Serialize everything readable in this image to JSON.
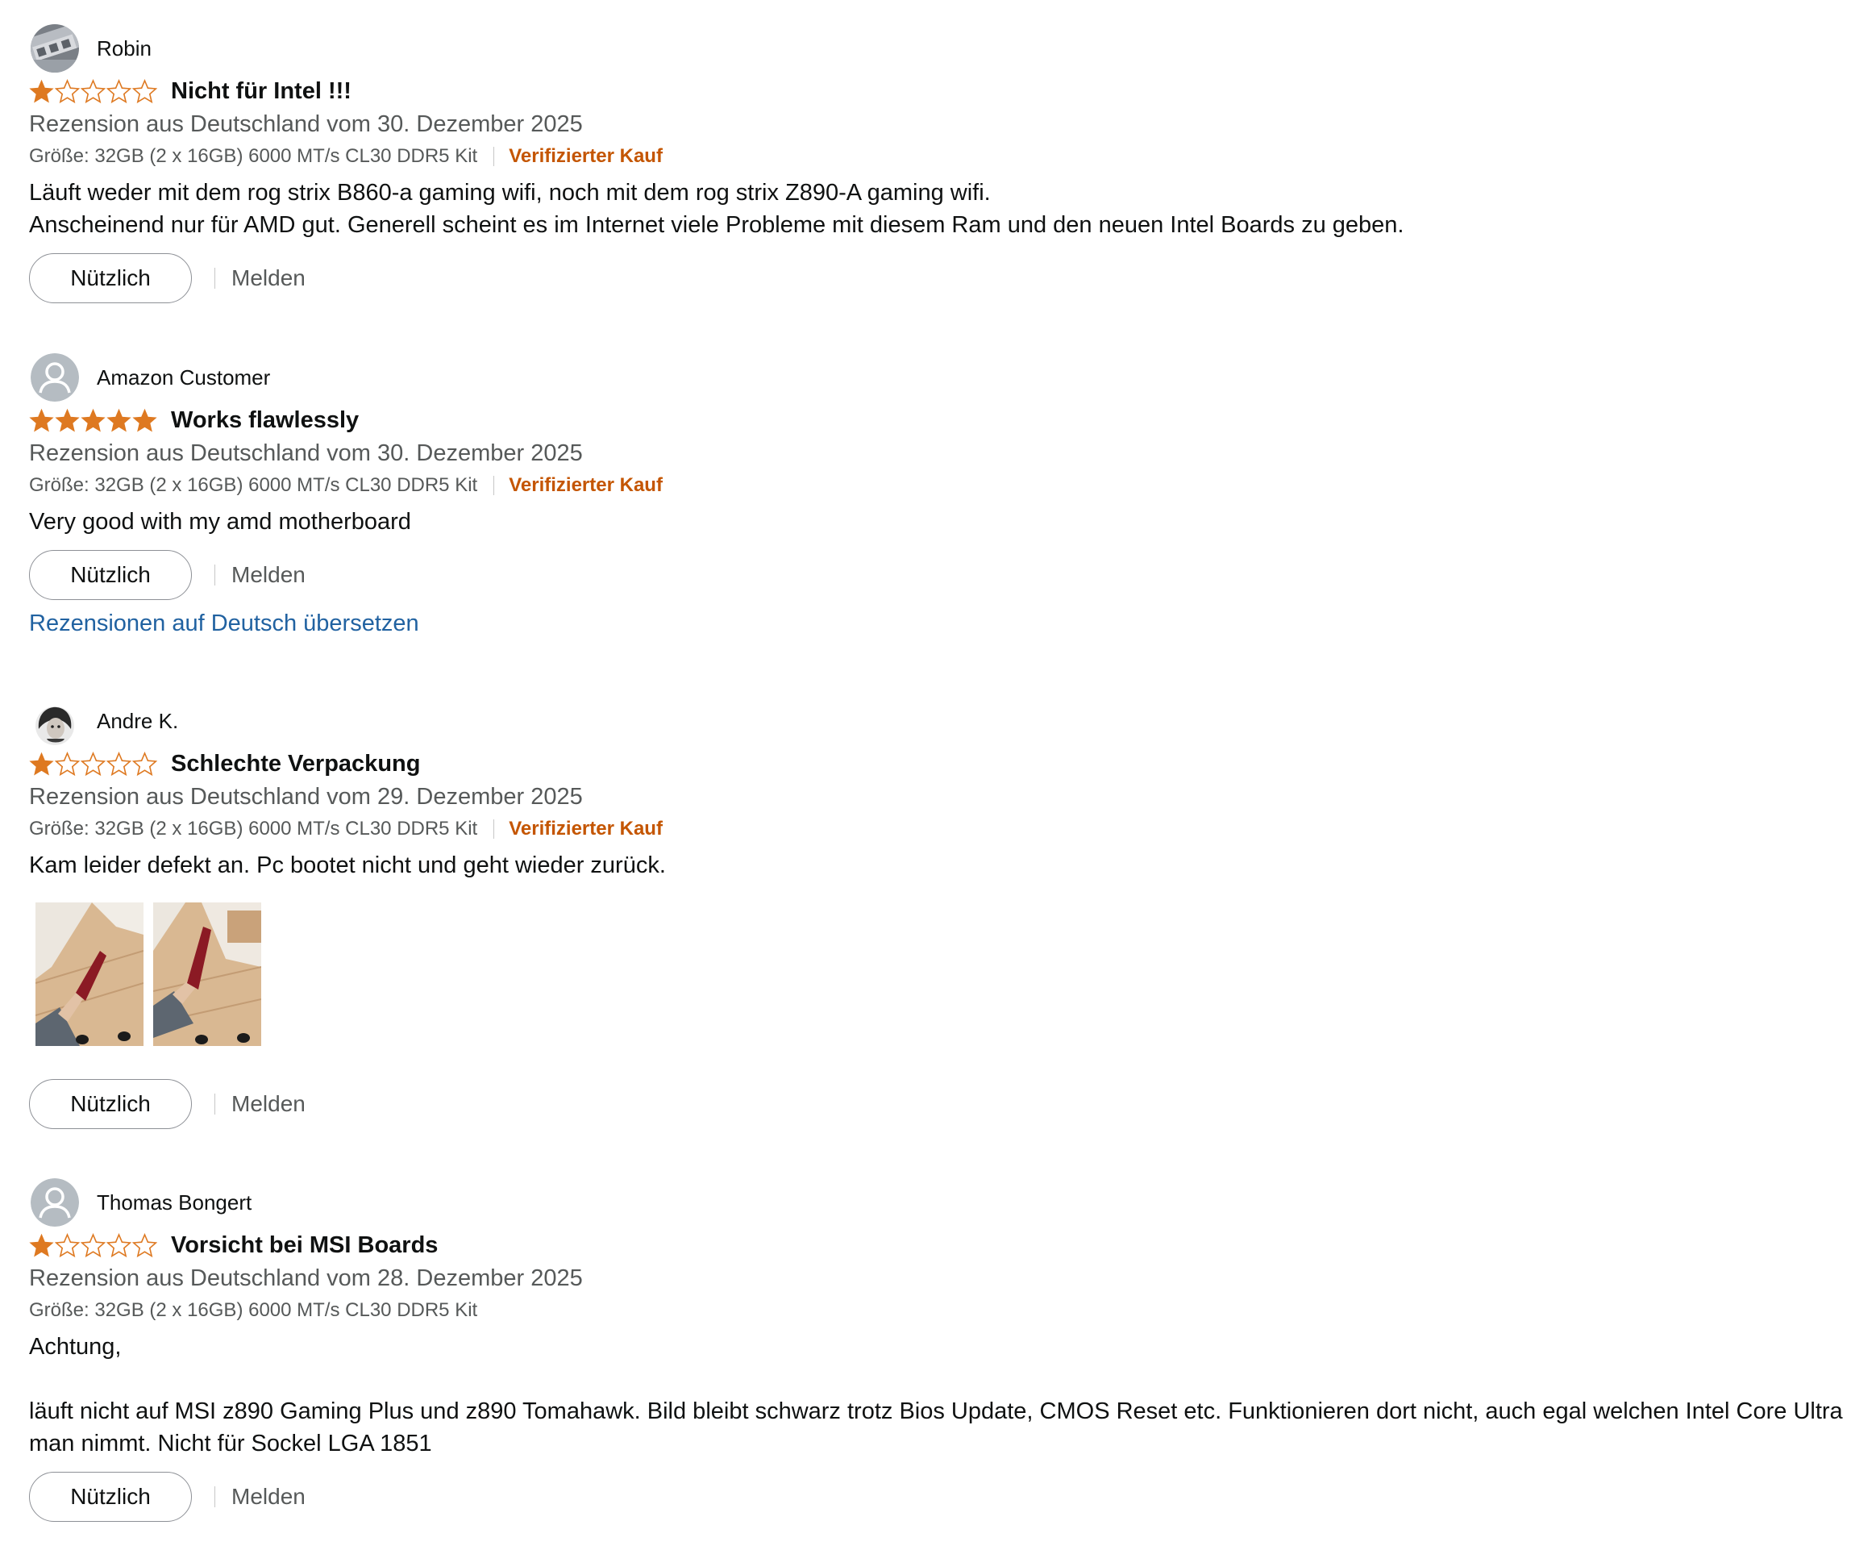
{
  "reviews": [
    {
      "reviewer": "Robin",
      "avatar_icon": "profile-photo-icon",
      "rating": 1,
      "max_rating": 5,
      "title": "Nicht für Intel !!!",
      "date_line": "Rezension aus Deutschland vom 30. Dezember 2025",
      "format": "Größe: 32GB (2 x 16GB) 6000 MT/s CL30 DDR5 Kit",
      "verified": "Verifizierter Kauf",
      "body": [
        "Läuft weder mit dem rog strix B860-a gaming wifi, noch mit dem rog strix Z890-A gaming wifi.",
        "Anscheinend nur für AMD gut. Generell scheint es im Internet viele Probleme mit diesem Ram und den neuen Intel Boards zu geben."
      ],
      "helpful_label": "Nützlich",
      "report_label": "Melden"
    },
    {
      "reviewer": "Amazon Customer",
      "avatar_icon": "default-user-icon",
      "rating": 5,
      "max_rating": 5,
      "title": "Works flawlessly",
      "date_line": "Rezension aus Deutschland vom 30. Dezember 2025",
      "format": "Größe: 32GB (2 x 16GB) 6000 MT/s CL30 DDR5 Kit",
      "verified": "Verifizierter Kauf",
      "body": [
        "Very good with my amd motherboard"
      ],
      "helpful_label": "Nützlich",
      "report_label": "Melden",
      "translate_label": "Rezensionen auf Deutsch übersetzen"
    },
    {
      "reviewer": "Andre K.",
      "avatar_icon": "profile-photo-icon",
      "rating": 1,
      "max_rating": 5,
      "title": "Schlechte Verpackung",
      "date_line": "Rezension aus Deutschland vom 29. Dezember 2025",
      "format": "Größe: 32GB (2 x 16GB) 6000 MT/s CL30 DDR5 Kit",
      "verified": "Verifizierter Kauf",
      "body": [
        "Kam leider defekt an. Pc bootet nicht und geht wieder zurück."
      ],
      "image_count": 2,
      "helpful_label": "Nützlich",
      "report_label": "Melden"
    },
    {
      "reviewer": "Thomas Bongert",
      "avatar_icon": "default-user-icon",
      "rating": 1,
      "max_rating": 5,
      "title": "Vorsicht bei MSI Boards",
      "date_line": "Rezension aus Deutschland vom 28. Dezember 2025",
      "format": "Größe: 32GB (2 x 16GB) 6000 MT/s CL30 DDR5 Kit",
      "verified": "",
      "body": [
        "Achtung,",
        "",
        "läuft nicht auf MSI z890 Gaming Plus und z890 Tomahawk. Bild bleibt schwarz trotz Bios Update, CMOS Reset etc. Funktionieren dort nicht, auch egal welchen Intel Core Ultra man nimmt. Nicht für Sockel LGA 1851"
      ],
      "helpful_label": "Nützlich",
      "report_label": "Melden"
    }
  ],
  "colors": {
    "star": "#de7921",
    "star_empty_stroke": "#de7921",
    "link": "#2162a1",
    "verified": "#c45500",
    "secondary_text": "#565959",
    "primary_text": "#0f1111"
  }
}
